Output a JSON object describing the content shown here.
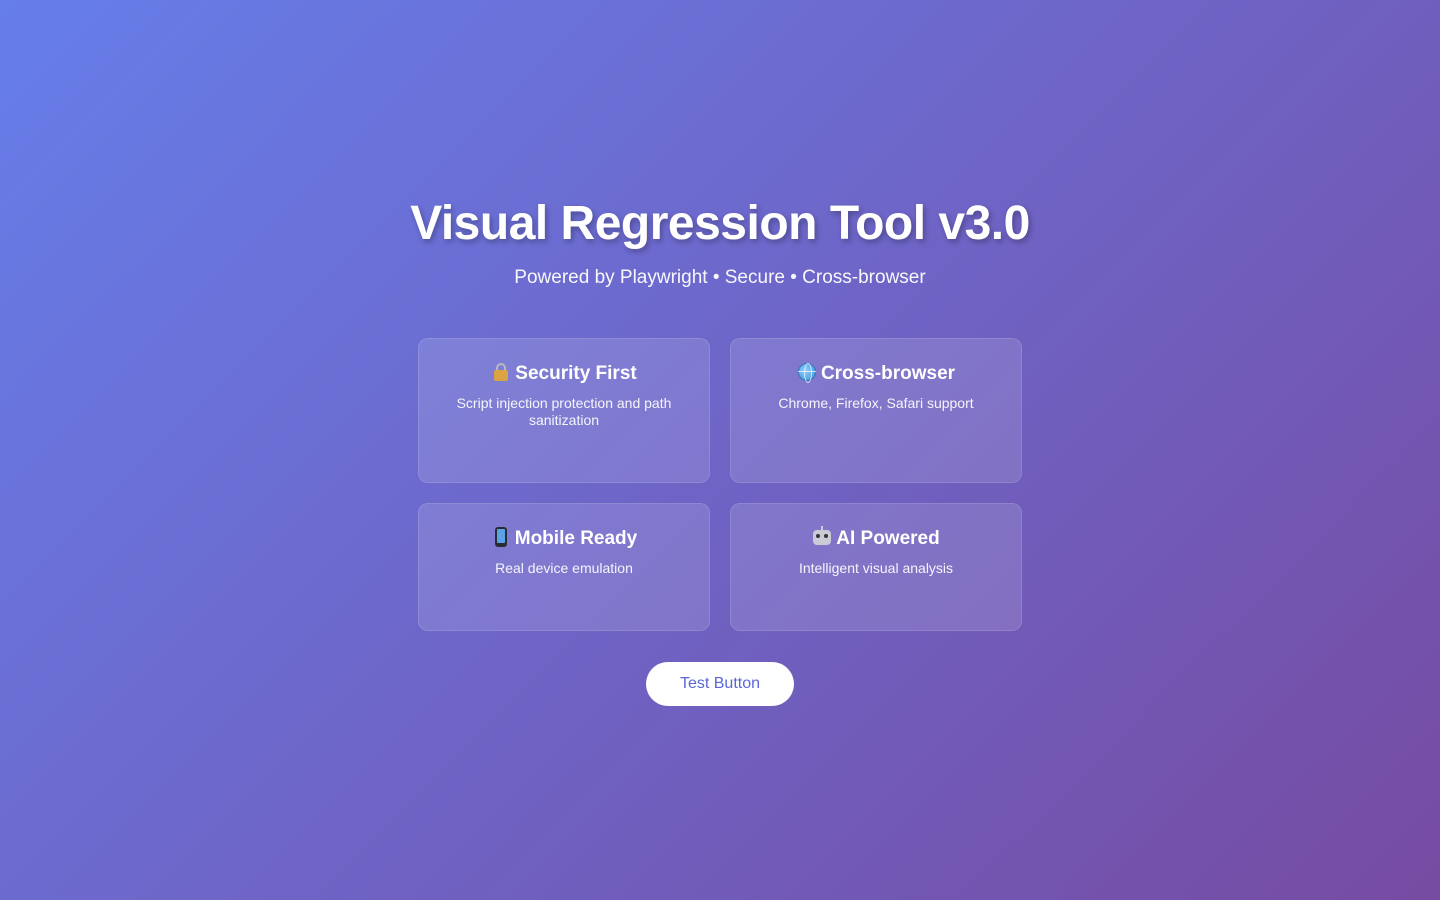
{
  "header": {
    "title": "Visual Regression Tool v3.0",
    "subtitle": "Powered by Playwright • Secure • Cross-browser"
  },
  "features": [
    {
      "icon": "lock-icon",
      "title": "Security First",
      "description": "Script injection protection and path sanitization"
    },
    {
      "icon": "globe-icon",
      "title": "Cross-browser",
      "description": "Chrome, Firefox, Safari support"
    },
    {
      "icon": "mobile-phone-icon",
      "title": "Mobile Ready",
      "description": "Real device emulation"
    },
    {
      "icon": "robot-icon",
      "title": "AI Powered",
      "description": "Intelligent visual analysis"
    }
  ],
  "actions": {
    "test_button_label": "Test Button"
  },
  "colors": {
    "gradient_start": "#667eea",
    "gradient_end": "#764ba2",
    "button_text": "#5a67d8"
  }
}
